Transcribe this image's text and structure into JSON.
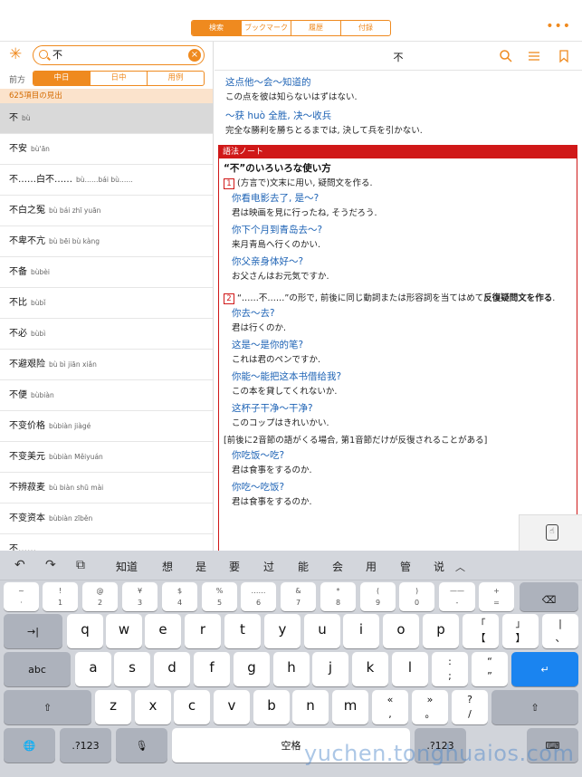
{
  "topbar": {
    "tabs": [
      "検索",
      "ブックマーク",
      "履歴",
      "付録"
    ],
    "more_label": "•••"
  },
  "search": {
    "query": "不",
    "direction_label": "前方",
    "modes": [
      "中日",
      "日中",
      "用例"
    ],
    "result_count": "625項目の見出"
  },
  "results": [
    {
      "hw": "不",
      "py": "bù"
    },
    {
      "hw": "不安",
      "py": "bù'ān"
    },
    {
      "hw": "不……白不……",
      "py": "bù……bái bù……"
    },
    {
      "hw": "不白之冤",
      "py": "bù bái zhī yuān"
    },
    {
      "hw": "不卑不亢",
      "py": "bù bēi bù kàng"
    },
    {
      "hw": "不备",
      "py": "bùbèi"
    },
    {
      "hw": "不比",
      "py": "bùbǐ"
    },
    {
      "hw": "不必",
      "py": "bùbì"
    },
    {
      "hw": "不避艰险",
      "py": "bù bì jiān xiǎn"
    },
    {
      "hw": "不便",
      "py": "bùbiàn"
    },
    {
      "hw": "不变价格",
      "py": "bùbiàn jiàgé"
    },
    {
      "hw": "不变美元",
      "py": "bùbiàn Měiyuán"
    },
    {
      "hw": "不辨菽麦",
      "py": "bù biàn shū mài"
    },
    {
      "hw": "不变资本",
      "py": "bùbiàn zīběn"
    },
    {
      "hw": "不……",
      "py": ""
    }
  ],
  "entry": {
    "title": "不",
    "examples_top": [
      {
        "zh": "这点他～会～知道的",
        "jp": "この点を彼は知らないはずはない."
      },
      {
        "zh": "～获 huò 全胜, 决～收兵",
        "jp": "完全な勝利を勝ちとるまでは, 決して兵を引かない."
      }
    ],
    "note": {
      "header": "語法ノート",
      "title": "“不”のいろいろな使い方",
      "p1_num": "1",
      "p1_text": "(方言で)文末に用い, 疑問文を作る.",
      "p1_examples": [
        {
          "zh": "你看电影去了, 是～?",
          "jp": "君は映画を見に行ったね, そうだろう."
        },
        {
          "zh": "你下个月到青岛去～?",
          "jp": "来月青島へ行くのかい."
        },
        {
          "zh": "你父亲身体好～?",
          "jp": "お父さんはお元気ですか."
        }
      ],
      "p2_num": "2",
      "p2_text": "“……不……”の形で, 前後に同じ動詞または形容詞を当てはめて",
      "p2_bold": "反復疑問文を作る",
      "p2_end": ".",
      "p2_examples": [
        {
          "zh": "你去～去?",
          "jp": "君は行くのか."
        },
        {
          "zh": "这是～是你的笔?",
          "jp": "これは君のペンですか."
        },
        {
          "zh": "你能～能把这本书借给我?",
          "jp": "この本を貸してくれないか."
        },
        {
          "zh": "这杯子干净～干净?",
          "jp": "このコップはきれいかい."
        }
      ],
      "comment": "[前後に2音節の語がくる場合, 第1音節だけが反復されることがある]",
      "p3_examples": [
        {
          "zh": "你吃饭～吃?",
          "jp": "君は食事をするのか."
        },
        {
          "zh": "你吃～吃饭?",
          "jp": "君は食事をするのか."
        }
      ]
    }
  },
  "keyboard": {
    "candidates": [
      "知道",
      "想",
      "是",
      "要",
      "过",
      "能",
      "会",
      "用",
      "管",
      "说"
    ],
    "row1": [
      {
        "t": "~",
        "b": "·"
      },
      {
        "t": "!",
        "b": "1"
      },
      {
        "t": "@",
        "b": "2"
      },
      {
        "t": "¥",
        "b": "3"
      },
      {
        "t": "$",
        "b": "4"
      },
      {
        "t": "%",
        "b": "5"
      },
      {
        "t": "……",
        "b": "6"
      },
      {
        "t": "&",
        "b": "7"
      },
      {
        "t": "*",
        "b": "8"
      },
      {
        "t": "(",
        "b": "9"
      },
      {
        "t": ")",
        "b": "0"
      },
      {
        "t": "——",
        "b": "-"
      },
      {
        "t": "+",
        "b": "="
      }
    ],
    "row2": [
      "q",
      "w",
      "e",
      "r",
      "t",
      "y",
      "u",
      "i",
      "o",
      "p"
    ],
    "row2_extra": [
      {
        "t": "「",
        "b": "【"
      },
      {
        "t": "」",
        "b": "】"
      },
      {
        "t": "|",
        "b": "、"
      }
    ],
    "row3": [
      "a",
      "s",
      "d",
      "f",
      "g",
      "h",
      "j",
      "k",
      "l"
    ],
    "row3_extra": [
      {
        "t": ":",
        "b": ";"
      },
      {
        "t": "“",
        "b": "”"
      }
    ],
    "row4": [
      "z",
      "x",
      "c",
      "v",
      "b",
      "n",
      "m"
    ],
    "row4_extra": [
      {
        "t": "«",
        "b": ","
      },
      {
        "t": "»",
        "b": "。"
      },
      {
        "t": "?",
        "b": "/"
      }
    ],
    "abc_label": "abc",
    "num_label": ".?123",
    "space_label": "空格",
    "tab_glyph": "→|",
    "delete_glyph": "⌫",
    "return_glyph": "↵",
    "shift_glyph": "⇧",
    "globe_glyph": "🌐",
    "mic_glyph": "🎙",
    "hide_glyph": "⌨"
  },
  "watermark": "yuchen.tonghuaios.com",
  "colors": {
    "accent": "#ef8a1f",
    "note_red": "#d01818",
    "zh_blue": "#1e63b5",
    "return_blue": "#1a84f0"
  }
}
